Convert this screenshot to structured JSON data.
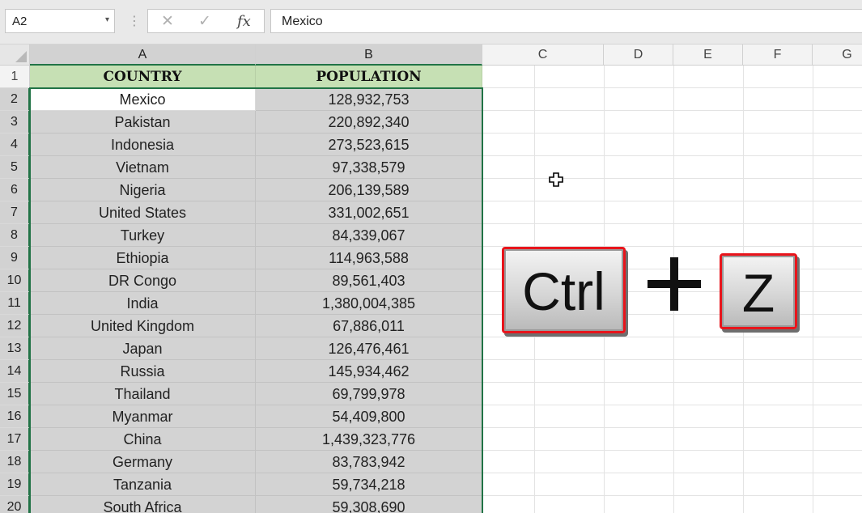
{
  "formula_bar": {
    "name_box": "A2",
    "name_box_arrow": "▾",
    "cancel_icon": "✕",
    "enter_icon": "✓",
    "fx_label": "fx",
    "formula_value": "Mexico"
  },
  "columns": [
    "A",
    "B",
    "C",
    "D",
    "E",
    "F",
    "G"
  ],
  "rows": [
    "1",
    "2",
    "3",
    "4",
    "5",
    "6",
    "7",
    "8",
    "9",
    "10",
    "11",
    "12",
    "13",
    "14",
    "15",
    "16",
    "17",
    "18",
    "19",
    "20"
  ],
  "table": {
    "headers": [
      "COUNTRY",
      "POPULATION"
    ],
    "records": [
      [
        "Mexico",
        "128,932,753"
      ],
      [
        "Pakistan",
        "220,892,340"
      ],
      [
        "Indonesia",
        "273,523,615"
      ],
      [
        "Vietnam",
        "97,338,579"
      ],
      [
        "Nigeria",
        "206,139,589"
      ],
      [
        "United States",
        "331,002,651"
      ],
      [
        "Turkey",
        "84,339,067"
      ],
      [
        "Ethiopia",
        "114,963,588"
      ],
      [
        "DR Congo",
        "89,561,403"
      ],
      [
        "India",
        "1,380,004,385"
      ],
      [
        "United Kingdom",
        "67,886,011"
      ],
      [
        "Japan",
        "126,476,461"
      ],
      [
        "Russia",
        "145,934,462"
      ],
      [
        "Thailand",
        "69,799,978"
      ],
      [
        "Myanmar",
        "54,409,800"
      ],
      [
        "China",
        "1,439,323,776"
      ],
      [
        "Germany",
        "83,783,942"
      ],
      [
        "Tanzania",
        "59,734,218"
      ],
      [
        "South Africa",
        "59,308,690"
      ]
    ]
  },
  "shortcut": {
    "key1": "Ctrl",
    "key2": "Z",
    "plus_icon": "plus-icon"
  },
  "colors": {
    "header_fill": "#c6e0b4",
    "selection_fill": "#d3d3d3",
    "selection_border": "#217346",
    "key_highlight": "#e8141b"
  }
}
